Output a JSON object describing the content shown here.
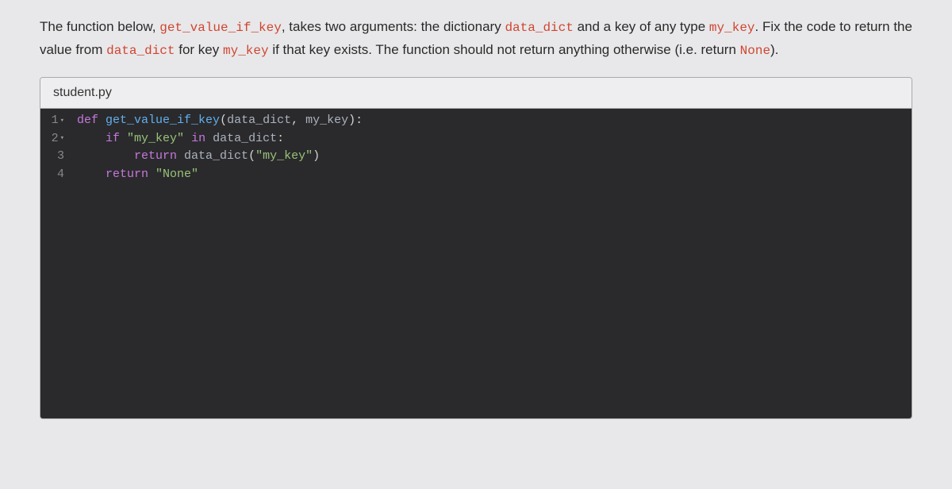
{
  "prompt": {
    "t1": "The function below, ",
    "c1": "get_value_if_key",
    "t2": ", takes two arguments: the dictionary ",
    "c2": "data_dict",
    "t3": " and a key of any type ",
    "c3": "my_key",
    "t4": ". Fix the code to return the value from ",
    "c4": "data_dict",
    "t5": " for key ",
    "c5": "my_key",
    "t6": " if that key exists. The function should not return anything otherwise (i.e. return ",
    "c6": "None",
    "t7": ")."
  },
  "editor": {
    "filename": "student.py",
    "gutter": {
      "l1": "1",
      "l2": "2",
      "l3": "3",
      "l4": "4",
      "fold": "▾"
    },
    "code": {
      "line1": {
        "kw_def": "def",
        "sp1": " ",
        "fn_name": "get_value_if_key",
        "paren_open": "(",
        "p1": "data_dict",
        "comma": ", ",
        "p2": "my_key",
        "paren_close": ")",
        "colon": ":"
      },
      "line2": {
        "indent": "    ",
        "kw_if": "if",
        "sp1": " ",
        "str1": "\"my_key\"",
        "sp2": " ",
        "kw_in": "in",
        "sp3": " ",
        "var": "data_dict",
        "colon": ":"
      },
      "line3": {
        "indent": "        ",
        "kw_return": "return",
        "sp1": " ",
        "var": "data_dict",
        "paren_open": "(",
        "str1": "\"my_key\"",
        "paren_close": ")"
      },
      "line4": {
        "indent": "    ",
        "kw_return": "return",
        "sp1": " ",
        "str1": "\"None\""
      }
    }
  }
}
